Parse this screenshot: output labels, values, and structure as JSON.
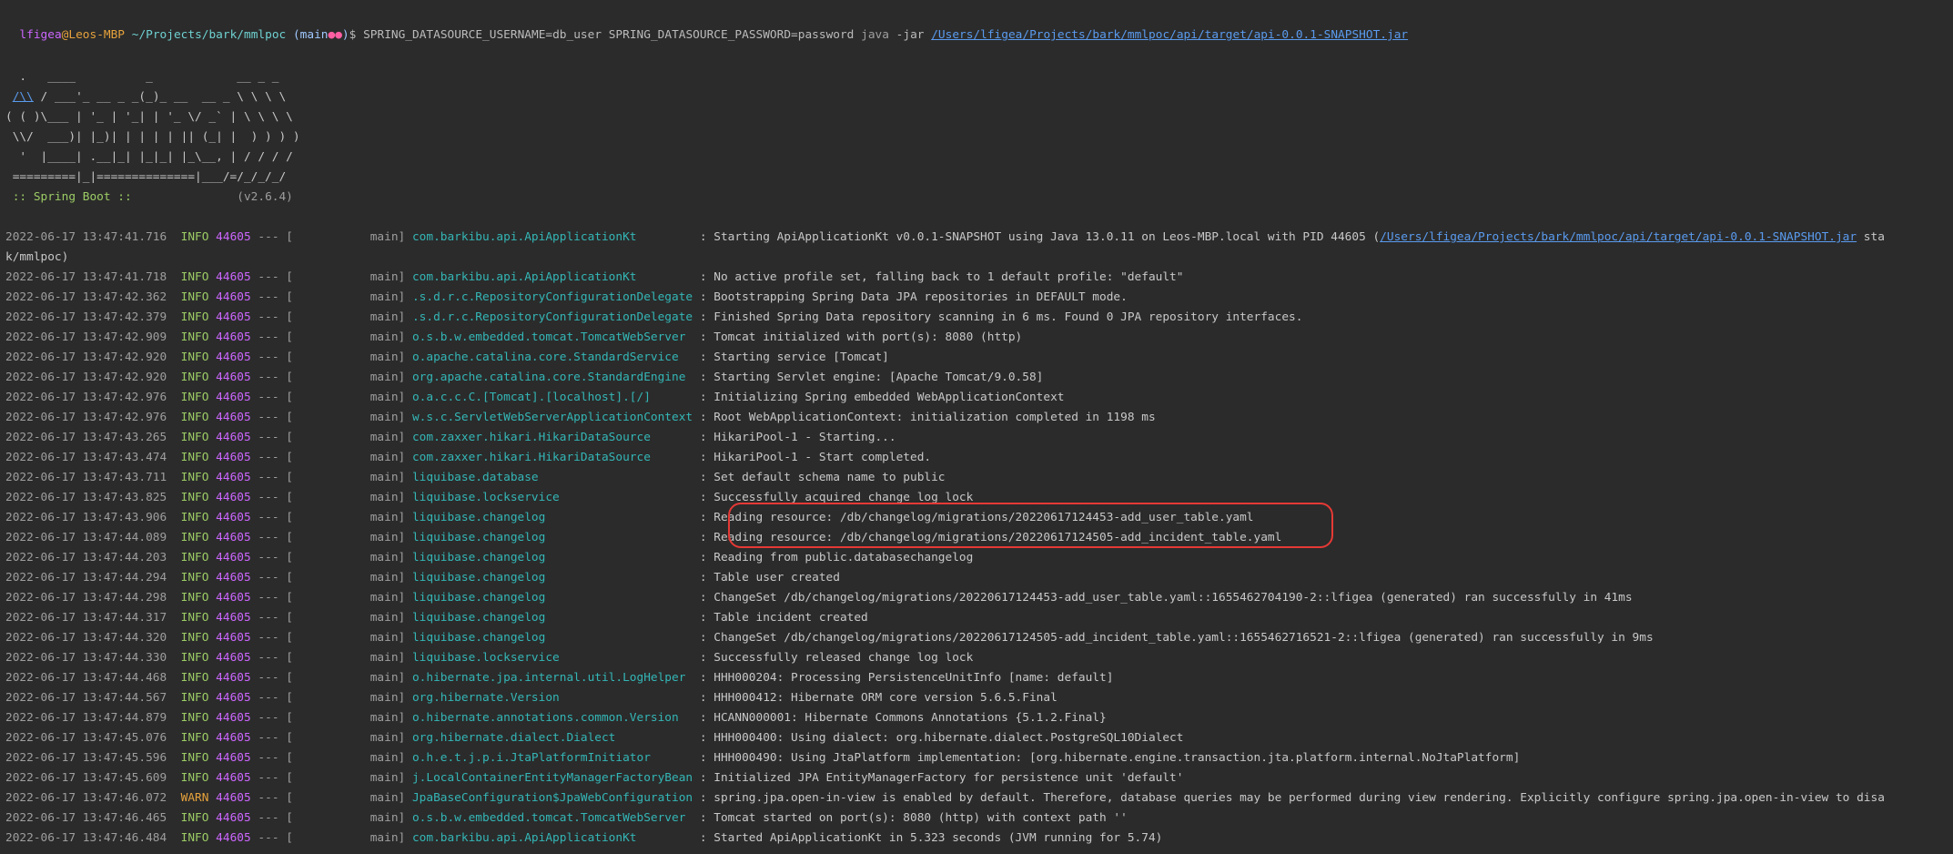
{
  "prompt": {
    "user": "lfigea",
    "at": "@",
    "host": "Leos-MBP",
    "path": "~/Projects/bark/mmlpoc",
    "branch_open": "(",
    "branch": "main",
    "dots": "●●",
    "branch_close": ")",
    "dollar": "$",
    "env": "SPRING_DATASOURCE_USERNAME=db_user SPRING_DATASOURCE_PASSWORD=password",
    "java": "java",
    "args": "-jar",
    "jar": "/Users/lfigea/Projects/bark/mmlpoc/api/target/api-0.0.1-SNAPSHOT.jar"
  },
  "banner": {
    "l1": "  .   ____          _            __ _ _",
    "l2a": " ",
    "l2b": "/\\\\",
    "l2c": " / ___'_ __ _ _(_)_ __  __ _ \\ \\ \\ \\",
    "l3": "( ( )\\___ | '_ | '_| | '_ \\/ _` | \\ \\ \\ \\",
    "l4": " \\\\/  ___)| |_)| | | | | || (_| |  ) ) ) )",
    "l5": "  '  |____| .__|_| |_|_| |_\\__, | / / / /",
    "l6": " =========|_|==============|___/=/_/_/_/",
    "spring": " :: Spring Boot :: ",
    "version": "              (v2.6.4)"
  },
  "logs": [
    {
      "ts": "2022-06-17 13:47:41.716",
      "level": "INFO",
      "pid": "44605",
      "sep": "--- [",
      "thread": "           main]",
      "logger": "com.barkibu.api.ApiApplicationKt        ",
      "msg": ": Starting ApiApplicationKt v0.0.1-SNAPSHOT using Java 13.0.11 on Leos-MBP.local with PID 44605 (",
      "link": "/Users/lfigea/Projects/bark/mmlpoc/api/target/api-0.0.1-SNAPSHOT.jar",
      "tail": " sta"
    },
    {
      "ts": "2022-06-17 13:47:41.718",
      "level": "INFO",
      "pid": "44605",
      "sep": "--- [",
      "thread": "           main]",
      "logger": "com.barkibu.api.ApiApplicationKt        ",
      "msg": ": No active profile set, falling back to 1 default profile: \"default\""
    },
    {
      "ts": "2022-06-17 13:47:42.362",
      "level": "INFO",
      "pid": "44605",
      "sep": "--- [",
      "thread": "           main]",
      "logger": ".s.d.r.c.RepositoryConfigurationDelegate",
      "msg": ": Bootstrapping Spring Data JPA repositories in DEFAULT mode."
    },
    {
      "ts": "2022-06-17 13:47:42.379",
      "level": "INFO",
      "pid": "44605",
      "sep": "--- [",
      "thread": "           main]",
      "logger": ".s.d.r.c.RepositoryConfigurationDelegate",
      "msg": ": Finished Spring Data repository scanning in 6 ms. Found 0 JPA repository interfaces."
    },
    {
      "ts": "2022-06-17 13:47:42.909",
      "level": "INFO",
      "pid": "44605",
      "sep": "--- [",
      "thread": "           main]",
      "logger": "o.s.b.w.embedded.tomcat.TomcatWebServer ",
      "msg": ": Tomcat initialized with port(s): 8080 (http)"
    },
    {
      "ts": "2022-06-17 13:47:42.920",
      "level": "INFO",
      "pid": "44605",
      "sep": "--- [",
      "thread": "           main]",
      "logger": "o.apache.catalina.core.StandardService  ",
      "msg": ": Starting service [Tomcat]"
    },
    {
      "ts": "2022-06-17 13:47:42.920",
      "level": "INFO",
      "pid": "44605",
      "sep": "--- [",
      "thread": "           main]",
      "logger": "org.apache.catalina.core.StandardEngine ",
      "msg": ": Starting Servlet engine: [Apache Tomcat/9.0.58]"
    },
    {
      "ts": "2022-06-17 13:47:42.976",
      "level": "INFO",
      "pid": "44605",
      "sep": "--- [",
      "thread": "           main]",
      "logger": "o.a.c.c.C.[Tomcat].[localhost].[/]      ",
      "msg": ": Initializing Spring embedded WebApplicationContext"
    },
    {
      "ts": "2022-06-17 13:47:42.976",
      "level": "INFO",
      "pid": "44605",
      "sep": "--- [",
      "thread": "           main]",
      "logger": "w.s.c.ServletWebServerApplicationContext",
      "msg": ": Root WebApplicationContext: initialization completed in 1198 ms"
    },
    {
      "ts": "2022-06-17 13:47:43.265",
      "level": "INFO",
      "pid": "44605",
      "sep": "--- [",
      "thread": "           main]",
      "logger": "com.zaxxer.hikari.HikariDataSource      ",
      "msg": ": HikariPool-1 - Starting..."
    },
    {
      "ts": "2022-06-17 13:47:43.474",
      "level": "INFO",
      "pid": "44605",
      "sep": "--- [",
      "thread": "           main]",
      "logger": "com.zaxxer.hikari.HikariDataSource      ",
      "msg": ": HikariPool-1 - Start completed."
    },
    {
      "ts": "2022-06-17 13:47:43.711",
      "level": "INFO",
      "pid": "44605",
      "sep": "--- [",
      "thread": "           main]",
      "logger": "liquibase.database                      ",
      "msg": ": Set default schema name to public"
    },
    {
      "ts": "2022-06-17 13:47:43.825",
      "level": "INFO",
      "pid": "44605",
      "sep": "--- [",
      "thread": "           main]",
      "logger": "liquibase.lockservice                   ",
      "msg": ": Successfully acquired change log lock"
    },
    {
      "ts": "2022-06-17 13:47:43.906",
      "level": "INFO",
      "pid": "44605",
      "sep": "--- [",
      "thread": "           main]",
      "logger": "liquibase.changelog                     ",
      "msg": ": Reading resource: /db/changelog/migrations/20220617124453-add_user_table.yaml"
    },
    {
      "ts": "2022-06-17 13:47:44.089",
      "level": "INFO",
      "pid": "44605",
      "sep": "--- [",
      "thread": "           main]",
      "logger": "liquibase.changelog                     ",
      "msg": ": Reading resource: /db/changelog/migrations/20220617124505-add_incident_table.yaml"
    },
    {
      "ts": "2022-06-17 13:47:44.203",
      "level": "INFO",
      "pid": "44605",
      "sep": "--- [",
      "thread": "           main]",
      "logger": "liquibase.changelog                     ",
      "msg": ": Reading from public.databasechangelog"
    },
    {
      "ts": "2022-06-17 13:47:44.294",
      "level": "INFO",
      "pid": "44605",
      "sep": "--- [",
      "thread": "           main]",
      "logger": "liquibase.changelog                     ",
      "msg": ": Table user created"
    },
    {
      "ts": "2022-06-17 13:47:44.298",
      "level": "INFO",
      "pid": "44605",
      "sep": "--- [",
      "thread": "           main]",
      "logger": "liquibase.changelog                     ",
      "msg": ": ChangeSet /db/changelog/migrations/20220617124453-add_user_table.yaml::1655462704190-2::lfigea (generated) ran successfully in 41ms"
    },
    {
      "ts": "2022-06-17 13:47:44.317",
      "level": "INFO",
      "pid": "44605",
      "sep": "--- [",
      "thread": "           main]",
      "logger": "liquibase.changelog                     ",
      "msg": ": Table incident created"
    },
    {
      "ts": "2022-06-17 13:47:44.320",
      "level": "INFO",
      "pid": "44605",
      "sep": "--- [",
      "thread": "           main]",
      "logger": "liquibase.changelog                     ",
      "msg": ": ChangeSet /db/changelog/migrations/20220617124505-add_incident_table.yaml::1655462716521-2::lfigea (generated) ran successfully in 9ms"
    },
    {
      "ts": "2022-06-17 13:47:44.330",
      "level": "INFO",
      "pid": "44605",
      "sep": "--- [",
      "thread": "           main]",
      "logger": "liquibase.lockservice                   ",
      "msg": ": Successfully released change log lock"
    },
    {
      "ts": "2022-06-17 13:47:44.468",
      "level": "INFO",
      "pid": "44605",
      "sep": "--- [",
      "thread": "           main]",
      "logger": "o.hibernate.jpa.internal.util.LogHelper ",
      "msg": ": HHH000204: Processing PersistenceUnitInfo [name: default]"
    },
    {
      "ts": "2022-06-17 13:47:44.567",
      "level": "INFO",
      "pid": "44605",
      "sep": "--- [",
      "thread": "           main]",
      "logger": "org.hibernate.Version                   ",
      "msg": ": HHH000412: Hibernate ORM core version 5.6.5.Final"
    },
    {
      "ts": "2022-06-17 13:47:44.879",
      "level": "INFO",
      "pid": "44605",
      "sep": "--- [",
      "thread": "           main]",
      "logger": "o.hibernate.annotations.common.Version  ",
      "msg": ": HCANN000001: Hibernate Commons Annotations {5.1.2.Final}"
    },
    {
      "ts": "2022-06-17 13:47:45.076",
      "level": "INFO",
      "pid": "44605",
      "sep": "--- [",
      "thread": "           main]",
      "logger": "org.hibernate.dialect.Dialect           ",
      "msg": ": HHH000400: Using dialect: org.hibernate.dialect.PostgreSQL10Dialect"
    },
    {
      "ts": "2022-06-17 13:47:45.596",
      "level": "INFO",
      "pid": "44605",
      "sep": "--- [",
      "thread": "           main]",
      "logger": "o.h.e.t.j.p.i.JtaPlatformInitiator      ",
      "msg": ": HHH000490: Using JtaPlatform implementation: [org.hibernate.engine.transaction.jta.platform.internal.NoJtaPlatform]"
    },
    {
      "ts": "2022-06-17 13:47:45.609",
      "level": "INFO",
      "pid": "44605",
      "sep": "--- [",
      "thread": "           main]",
      "logger": "j.LocalContainerEntityManagerFactoryBean",
      "msg": ": Initialized JPA EntityManagerFactory for persistence unit 'default'"
    },
    {
      "ts": "2022-06-17 13:47:46.072",
      "level": "WARN",
      "pid": "44605",
      "sep": "--- [",
      "thread": "           main]",
      "logger": "JpaBaseConfiguration$JpaWebConfiguration",
      "msg": ": spring.jpa.open-in-view is enabled by default. Therefore, database queries may be performed during view rendering. Explicitly configure spring.jpa.open-in-view to disa"
    },
    {
      "ts": "2022-06-17 13:47:46.465",
      "level": "INFO",
      "pid": "44605",
      "sep": "--- [",
      "thread": "           main]",
      "logger": "o.s.b.w.embedded.tomcat.TomcatWebServer ",
      "msg": ": Tomcat started on port(s): 8080 (http) with context path ''"
    },
    {
      "ts": "2022-06-17 13:47:46.484",
      "level": "INFO",
      "pid": "44605",
      "sep": "--- [",
      "thread": "           main]",
      "logger": "com.barkibu.api.ApiApplicationKt        ",
      "msg": ": Started ApiApplicationKt in 5.323 seconds (JVM running for 5.74)"
    }
  ],
  "wrap_line": "k/mmlpoc)"
}
